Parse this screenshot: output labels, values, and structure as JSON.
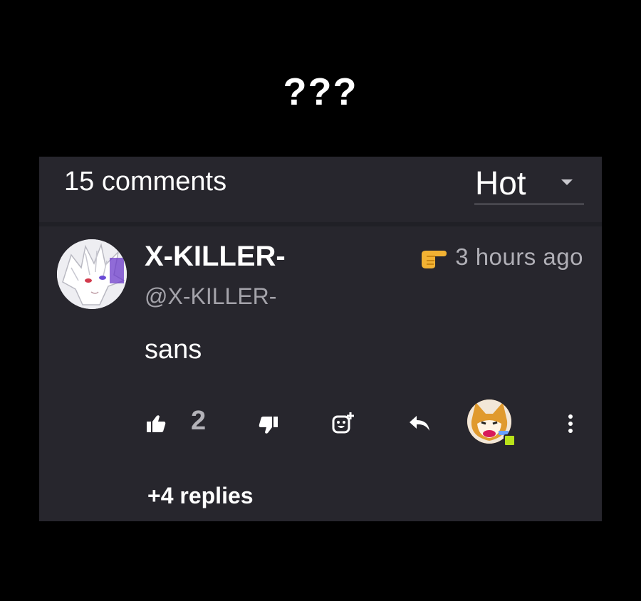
{
  "caption": "???",
  "comments_header": {
    "count_label": "15 comments",
    "sort_label": "Hot",
    "sort_caret_icon": "caret-down-icon"
  },
  "comment": {
    "author": "X-KILLER-",
    "handle": "@X-KILLER-",
    "pointer_icon": "pointing-hand-icon",
    "time": "3 hours ago",
    "text": "sans",
    "likes": "2",
    "replies_label": "+4 replies"
  },
  "colors": {
    "page_background": "#000000",
    "panel_background": "#27262d",
    "muted_text": "#a4a3aa",
    "online_indicator": "#b9e21a"
  }
}
